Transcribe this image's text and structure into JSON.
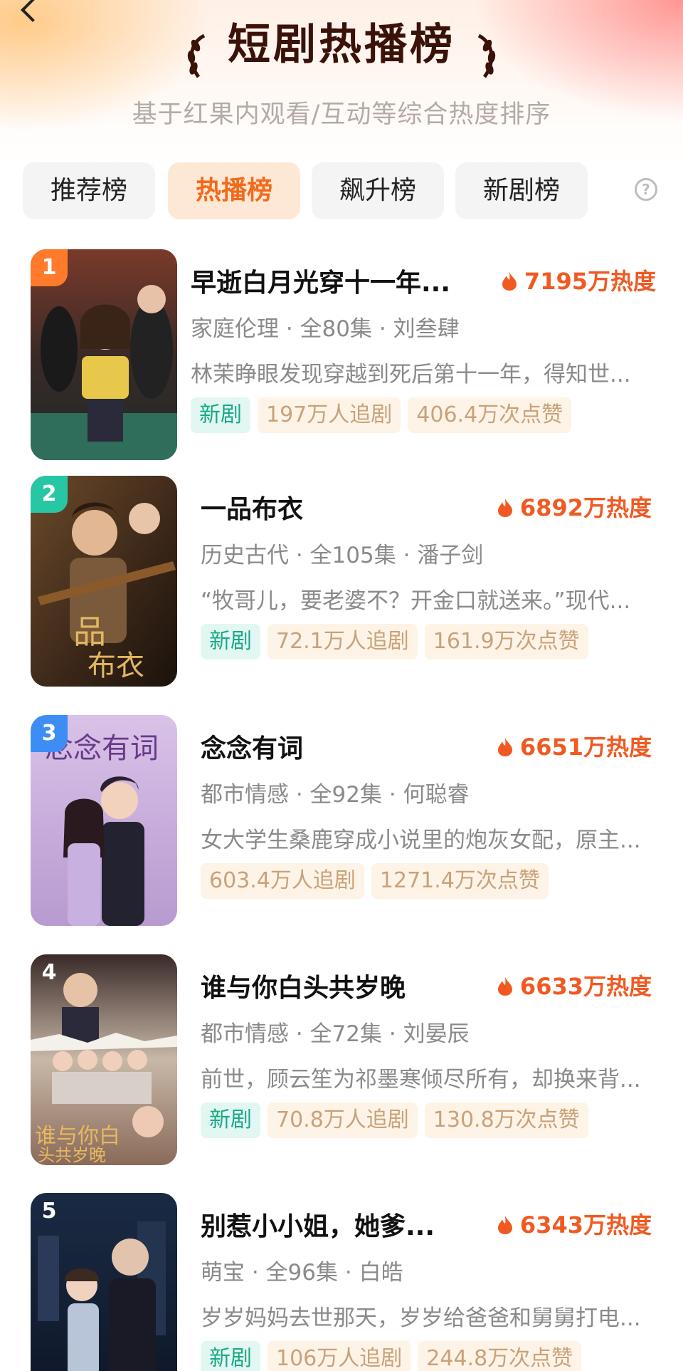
{
  "header": {
    "title": "短剧热播榜",
    "subtitle": "基于红果内观看/互动等综合热度排序"
  },
  "tabs": [
    {
      "label": "推荐榜",
      "active": false
    },
    {
      "label": "热播榜",
      "active": true
    },
    {
      "label": "飙升榜",
      "active": false
    },
    {
      "label": "新剧榜",
      "active": false
    }
  ],
  "help_icon": "?",
  "colors": {
    "accent": "#f26a1b",
    "heat": "#f05a22",
    "new_badge": "#1aa986",
    "stat_badge": "#c9a27a",
    "rank1": "#ff7a2a",
    "rank2": "#27c6a4",
    "rank3": "#3d8df5"
  },
  "shows": [
    {
      "rank": "1",
      "title": "早逝白月光穿十一年...",
      "heat": "7195万热度",
      "meta": "家庭伦理 · 全80集 · 刘叁肆",
      "desc": "林茉睁眼发现穿越到死后第十一年，得知世...",
      "badges": {
        "new": "新剧",
        "followers": "197万人追剧",
        "likes": "406.4万次点赞"
      }
    },
    {
      "rank": "2",
      "title": "一品布衣",
      "heat": "6892万热度",
      "meta": "历史古代 · 全105集 · 潘子剑",
      "desc": "“牧哥儿，要老婆不？开金口就送来。”现代...",
      "badges": {
        "new": "新剧",
        "followers": "72.1万人追剧",
        "likes": "161.9万次点赞"
      }
    },
    {
      "rank": "3",
      "title": "念念有词",
      "heat": "6651万热度",
      "meta": "都市情感 · 全92集 · 何聪睿",
      "desc": "女大学生桑鹿穿成小说里的炮灰女配，原主...",
      "badges": {
        "followers": "603.4万人追剧",
        "likes": "1271.4万次点赞"
      }
    },
    {
      "rank": "4",
      "title": "谁与你白头共岁晚",
      "heat": "6633万热度",
      "meta": "都市情感 · 全72集 · 刘晏辰",
      "desc": "前世，顾云笙为祁墨寒倾尽所有，却换来背...",
      "badges": {
        "new": "新剧",
        "followers": "70.8万人追剧",
        "likes": "130.8万次点赞"
      }
    },
    {
      "rank": "5",
      "title": "别惹小小姐，她爹...",
      "heat": "6343万热度",
      "meta": "萌宝 · 全96集 · 白皓",
      "desc": "岁岁妈妈去世那天，岁岁给爸爸和舅舅打电...",
      "badges": {
        "new": "新剧",
        "followers": "106万人追剧",
        "likes": "244.8万次点赞"
      }
    }
  ]
}
